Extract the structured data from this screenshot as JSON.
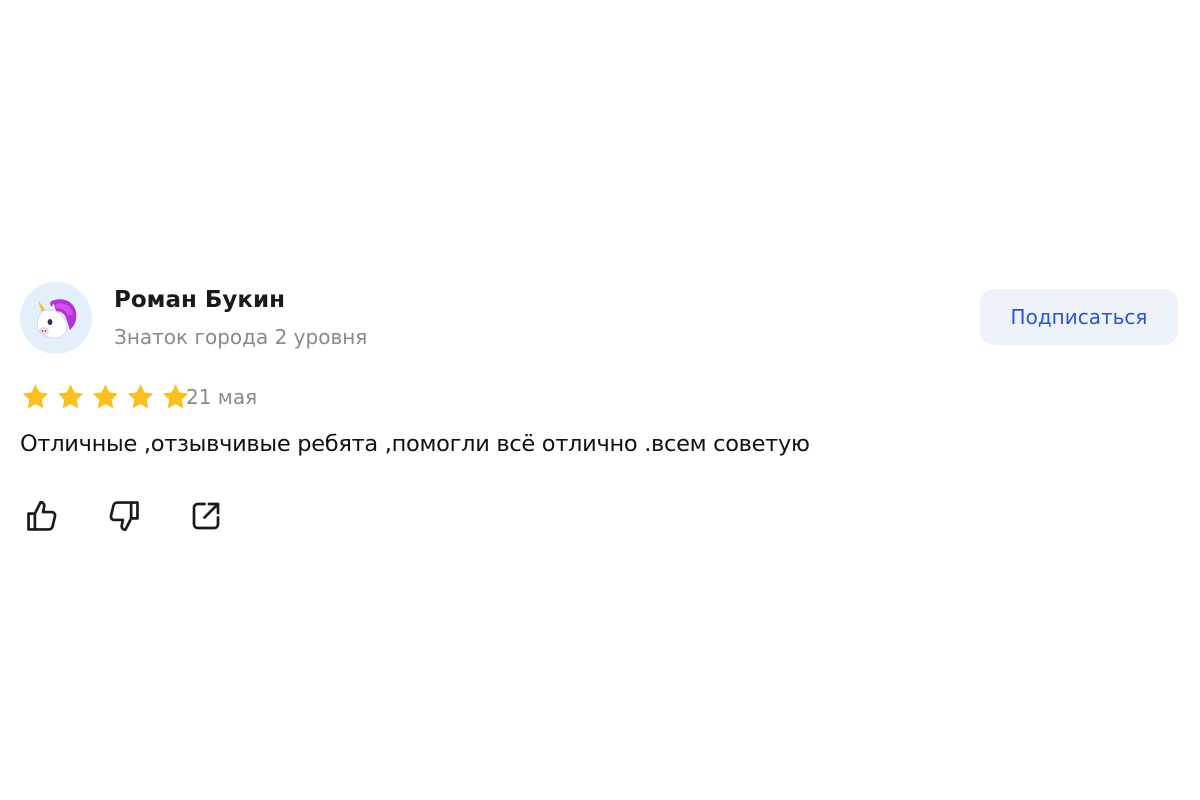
{
  "author": {
    "name": "Роман Букин",
    "level": "Знаток города 2 уровня",
    "avatar_icon": "unicorn-icon",
    "avatar_bg": "#e3f0fb"
  },
  "subscribe": {
    "label": "Подписаться",
    "color": "#2a55d4",
    "bg": "#eef3fb"
  },
  "rating": {
    "value": 5,
    "max": 5,
    "star_color": "#fbbf1f"
  },
  "review": {
    "date": "21 мая",
    "text": "Отличные ,отзывчивые ребята ,помогли всё отлично .всем советую"
  },
  "actions": [
    {
      "icon": "thumbs-up-icon"
    },
    {
      "icon": "thumbs-down-icon"
    },
    {
      "icon": "share-icon"
    }
  ]
}
